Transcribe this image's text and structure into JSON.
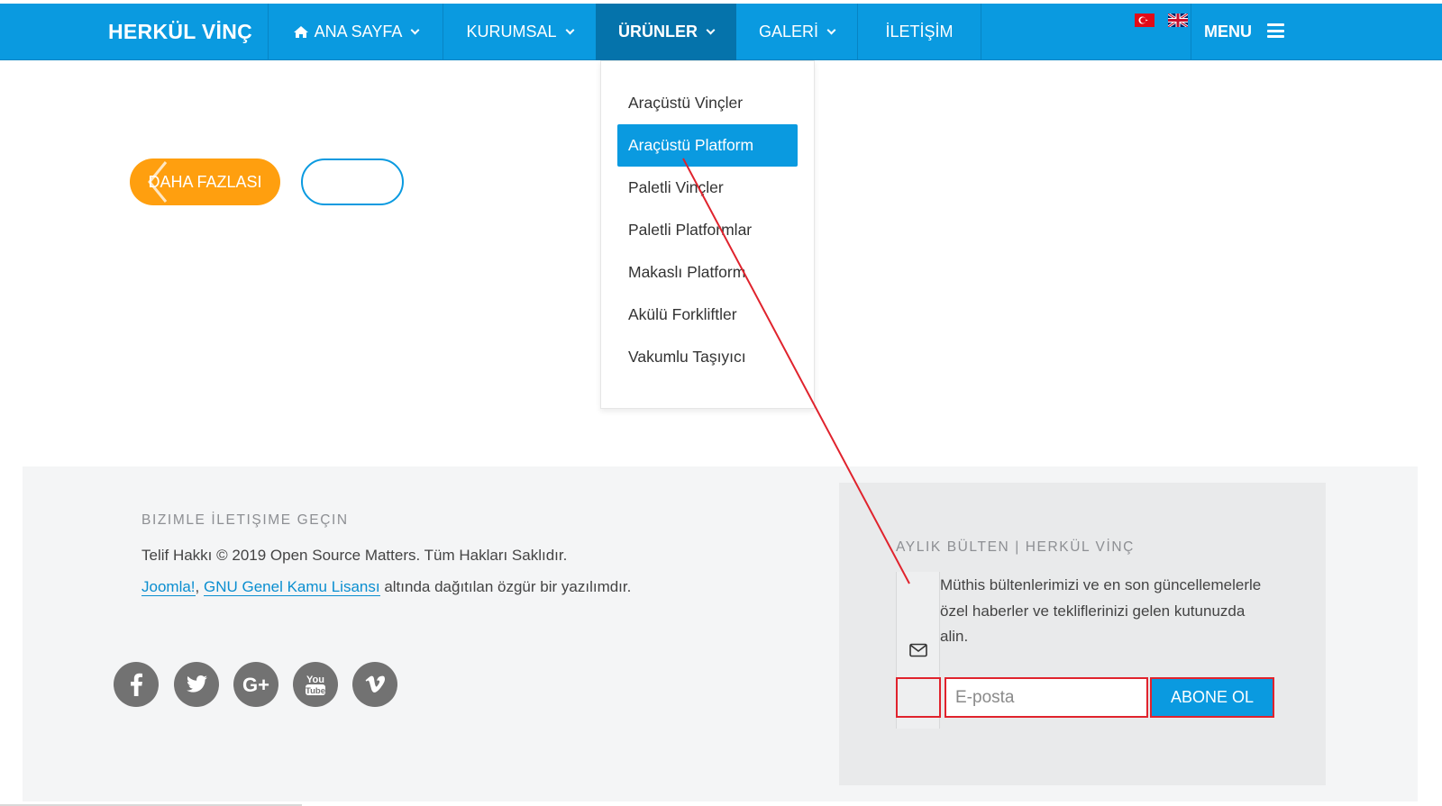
{
  "nav": {
    "brand": "HERKÜL VİNÇ",
    "items": [
      {
        "label": "ANA SAYFA"
      },
      {
        "label": "KURUMSAL"
      },
      {
        "label": "ÜRÜNLER"
      },
      {
        "label": "GALERİ"
      },
      {
        "label": "İLETİŞİM"
      }
    ],
    "menu_label": "MENU",
    "accent_color": "#0a9ae0",
    "active_color": "#0573ab"
  },
  "dropdown": {
    "items": [
      {
        "label": "Araçüstü Vinçler"
      },
      {
        "label": "Araçüstü Platform"
      },
      {
        "label": "Paletli Vinçler"
      },
      {
        "label": "Paletli Platformlar"
      },
      {
        "label": "Makaslı Platform"
      },
      {
        "label": "Akülü Forkliftler"
      },
      {
        "label": "Vakumlu Taşıyıcı"
      }
    ]
  },
  "hero": {
    "more_label": "DAHA FAZLASI",
    "more_color": "#ff9f0f"
  },
  "footer": {
    "heading": "BIZIMLE İLETIŞIME GEÇIN",
    "copyright": "Telif Hakkı © 2019 Open Source Matters. Tüm Hakları Saklıdır.",
    "link1": "Joomla!",
    "sep": ",",
    "link2": "GNU Genel Kamu Lisansı",
    "license_rest": " altında dağıtılan özgür bir yazılımdır.",
    "social": [
      "facebook-icon",
      "twitter-icon",
      "google-plus-icon",
      "youtube-icon",
      "vimeo-icon"
    ]
  },
  "newsletter": {
    "heading": "AYLIK BÜLTEN | HERKÜL VİNÇ",
    "text": "Müthis bültenlerimizi ve en son güncellemelerle özel haberler ve tekliflerinizi gelen kutunuzda alin.",
    "email_placeholder": "E-posta",
    "button_label": "ABONE OL",
    "highlight_color": "#e0232d"
  }
}
